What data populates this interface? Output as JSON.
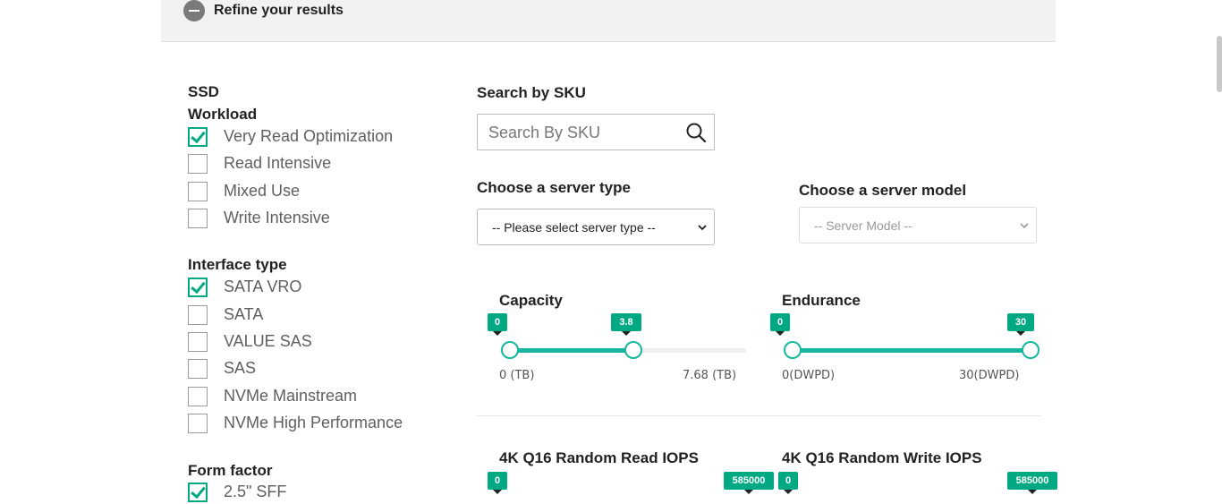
{
  "refine": {
    "label": "Refine your results"
  },
  "filters": {
    "category": "SSD",
    "workload": {
      "title": "Workload",
      "items": [
        {
          "label": "Very Read Optimization",
          "checked": true
        },
        {
          "label": "Read Intensive",
          "checked": false
        },
        {
          "label": "Mixed Use",
          "checked": false
        },
        {
          "label": "Write Intensive",
          "checked": false
        }
      ]
    },
    "interface": {
      "title": "Interface type",
      "items": [
        {
          "label": "SATA VRO",
          "checked": true
        },
        {
          "label": "SATA",
          "checked": false
        },
        {
          "label": "VALUE SAS",
          "checked": false
        },
        {
          "label": "SAS",
          "checked": false
        },
        {
          "label": "NVMe Mainstream",
          "checked": false
        },
        {
          "label": "NVMe High Performance",
          "checked": false
        }
      ]
    },
    "form_factor": {
      "title": "Form factor",
      "items": [
        {
          "label": "2.5\" SFF",
          "checked": true
        }
      ]
    }
  },
  "sku": {
    "title": "Search by SKU",
    "placeholder": "Search By SKU"
  },
  "server_type": {
    "title": "Choose a server type",
    "selected": "-- Please select server type --"
  },
  "server_model": {
    "title": "Choose a server model",
    "selected": "-- Server Model --"
  },
  "sliders": {
    "capacity": {
      "title": "Capacity",
      "min": 0,
      "max": 7.68,
      "low": 0,
      "high": 3.8,
      "low_tip": "0",
      "high_tip": "3.8",
      "min_label": "0 (TB)",
      "max_label": "7.68 (TB)"
    },
    "endurance": {
      "title": "Endurance",
      "min": 0,
      "max": 30,
      "low": 0,
      "high": 30,
      "low_tip": "0",
      "high_tip": "30",
      "min_label": "0(DWPD)",
      "max_label": "30(DWPD)"
    },
    "read_iops": {
      "title": "4K Q16 Random Read IOPS",
      "low_tip": "0",
      "high_tip": "585000"
    },
    "write_iops": {
      "title": "4K Q16 Random Write IOPS",
      "low_tip": "0",
      "high_tip": "585000"
    }
  },
  "colors": {
    "accent": "#01a982",
    "slider": "#17b69e",
    "bar": "#f2f2f2"
  }
}
